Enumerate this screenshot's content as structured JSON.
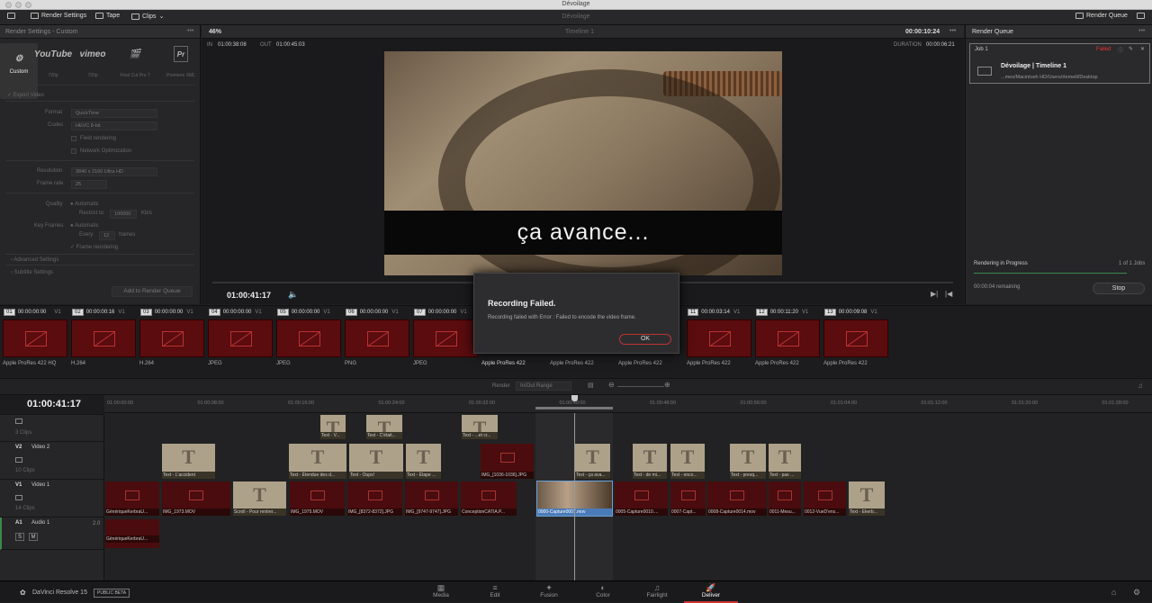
{
  "window": {
    "title": "Dévoilage"
  },
  "toolbar": {
    "render_settings": "Render Settings",
    "tape": "Tape",
    "clips": "Clips",
    "render_queue": "Render Queue"
  },
  "left_panel": {
    "title": "Render Settings - Custom",
    "presets": [
      {
        "logo": "Custom",
        "label": "Custom",
        "sub": ""
      },
      {
        "logo": "YouTube",
        "label": "",
        "sub": "720p"
      },
      {
        "logo": "vimeo",
        "label": "",
        "sub": "720p"
      },
      {
        "logo": "🎬",
        "label": "",
        "sub": "Final Cut Pro 7"
      },
      {
        "logo": "Pr",
        "label": "",
        "sub": "Premiere XML"
      }
    ],
    "export_video": "Export Video",
    "format_label": "Format",
    "format_value": "QuickTime",
    "codec_label": "Codec",
    "codec_value": "HEVC 8-bit",
    "field_rendering": "Field rendering",
    "network_optimization": "Network Optimization",
    "resolution_label": "Resolution",
    "resolution_value": "3840 x 2160 Ultra HD",
    "framerate_label": "Frame rate",
    "framerate_value": "25",
    "quality_label": "Quality",
    "quality_auto": "Automatic",
    "restrict_to": "Restrict to",
    "restrict_value": "100000",
    "kbs": "Kb/s",
    "keyframes_label": "Key Frames",
    "keyframes_auto": "Automatic",
    "every": "Every",
    "every_value": "12",
    "frames": "frames",
    "frame_reordering": "Frame reordering",
    "advanced": "Advanced Settings",
    "subtitle": "Subtitle Settings",
    "add_queue": "Add to Render Queue"
  },
  "viewer": {
    "zoom": "46%",
    "timeline_name": "Timeline 1",
    "timecode_top": "00:00:10:24",
    "in_label": "IN",
    "in_tc": "01:00:38:08",
    "out_label": "OUT",
    "out_tc": "01:00:45:03",
    "duration_label": "DURATION",
    "duration_tc": "00:00:06:21",
    "caption": "ça avance...",
    "current_tc": "01:00:41:17"
  },
  "render_queue": {
    "title": "Render Queue",
    "job": "Job 1",
    "status": "Failed",
    "job_title": "Dévoilage | Timeline 1",
    "job_path": "...mes/Macintosh HD/Users/rlemeill/Desktop",
    "progress_label": "Rendering in Progress",
    "count": "1 of 1 Jobs",
    "remaining": "00:00:04 remaining",
    "stop": "Stop"
  },
  "dialog": {
    "title": "Recording Failed.",
    "message": "Recording failed with Error : Failed to encode the video frame.",
    "ok": "OK"
  },
  "clips": [
    {
      "num": "01",
      "tc": "00:00:00:00",
      "v": "V1",
      "label": "Apple ProRes 422 HQ"
    },
    {
      "num": "02",
      "tc": "00:00:00:16",
      "v": "V1",
      "label": "H.264"
    },
    {
      "num": "03",
      "tc": "00:00:00:00",
      "v": "V1",
      "label": "H.264"
    },
    {
      "num": "04",
      "tc": "00:00:00:00",
      "v": "V1",
      "label": "JPEG"
    },
    {
      "num": "05",
      "tc": "00:00:00:00",
      "v": "V1",
      "label": "JPEG"
    },
    {
      "num": "06",
      "tc": "00:00:00:00",
      "v": "V1",
      "label": "PNG"
    },
    {
      "num": "07",
      "tc": "00:00:00:00",
      "v": "V1",
      "label": "JPEG"
    },
    {
      "num": "",
      "tc": "",
      "v": "",
      "label": "Apple ProRes 422"
    },
    {
      "num": "",
      "tc": "",
      "v": "",
      "label": "Apple ProRes 422"
    },
    {
      "num": "",
      "tc": "",
      "v": "",
      "label": "Apple ProRes 422"
    },
    {
      "num": "11",
      "tc": "00:00:03:14",
      "v": "V1",
      "label": "Apple ProRes 422"
    },
    {
      "num": "12",
      "tc": "00:00:11:20",
      "v": "V1",
      "label": "Apple ProRes 422"
    },
    {
      "num": "13",
      "tc": "00:00:09:08",
      "v": "V1",
      "label": "Apple ProRes 422"
    }
  ],
  "render_bar": {
    "render": "Render",
    "range": "In/Out Range"
  },
  "timeline": {
    "current_tc": "01:00:41:17",
    "ruler": [
      "01:00:00:00",
      "01:00:08:00",
      "01:00:16:00",
      "01:00:24:00",
      "01:00:32:00",
      "01:00:40:00",
      "01:00:48:00",
      "01:00:56:00",
      "01:01:04:00",
      "01:01:12:00",
      "01:01:20:00",
      "01:01:28:00"
    ],
    "tracks": {
      "v3_clips": "3 Clips",
      "v2_name": "V2",
      "v2_label": "Video 2",
      "v2_clips": "10 Clips",
      "v1_name": "V1",
      "v1_label": "Video 1",
      "v1_clips": "14 Clips",
      "a1_name": "A1",
      "a1_label": "Audio 1",
      "a1_level": "2.0",
      "s": "S",
      "m": "M"
    },
    "v3": [
      "Text - V...",
      "Text - C'était...",
      "Text - ...et cr..."
    ],
    "v2": [
      "Text - L'accident",
      "Text - Étendue des d...",
      "Text - Oups!",
      "Text - Étape ...",
      "IMG_[1036-1036].JPG",
      "Text - ça ava...",
      "Text - de mi...",
      "Text - enco...",
      "Text - presq...",
      "Text - pas ..."
    ],
    "v1": [
      "GénériqueKerbraU...",
      "IMG_1973.MOV",
      "Scroll - Pour rentrer...",
      "IMG_1975.MOV",
      "IMG_[8372-8372].JPG",
      "IMG_[9747-9747].JPG",
      "ConceptionCATIA.P...",
      "0000-Capture0007.mov",
      "0005-Capture0010....",
      "0007-Capt...",
      "0008-Capture0014.mov",
      "0011-Mesu...",
      "0012-VueD'ens...",
      "Text - Ekerb..."
    ],
    "a1": [
      "GénériqueKerbraU..."
    ]
  },
  "bottom": {
    "app": "DaVinci Resolve 15",
    "beta": "PUBLIC BETA",
    "pages": [
      "Media",
      "Edit",
      "Fusion",
      "Color",
      "Fairlight",
      "Deliver"
    ]
  }
}
